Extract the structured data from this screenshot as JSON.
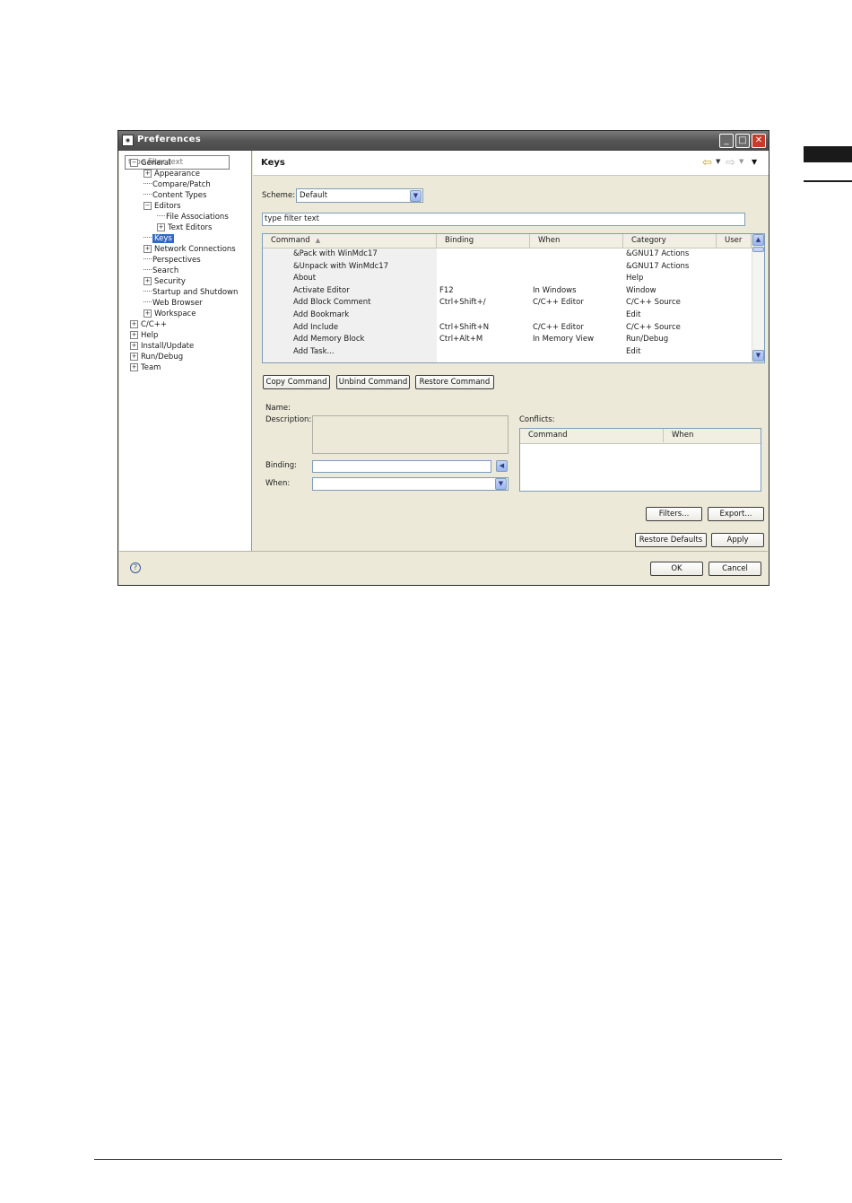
{
  "window": {
    "title": "Preferences",
    "minimize": "_",
    "maximize": "□",
    "close": "✕"
  },
  "sidebar": {
    "filter_placeholder": "type filter text",
    "items": [
      {
        "label": "General",
        "expander": "⊟"
      },
      {
        "label": "Appearance",
        "expander": "⊞"
      },
      {
        "label": "Compare/Patch",
        "expander": ""
      },
      {
        "label": "Content Types",
        "expander": ""
      },
      {
        "label": "Editors",
        "expander": "⊟"
      },
      {
        "label": "File Associations",
        "expander": ""
      },
      {
        "label": "Text Editors",
        "expander": "⊞"
      },
      {
        "label": "Keys",
        "expander": ""
      },
      {
        "label": "Network Connections",
        "expander": "⊞"
      },
      {
        "label": "Perspectives",
        "expander": ""
      },
      {
        "label": "Search",
        "expander": ""
      },
      {
        "label": "Security",
        "expander": "⊞"
      },
      {
        "label": "Startup and Shutdown",
        "expander": ""
      },
      {
        "label": "Web Browser",
        "expander": ""
      },
      {
        "label": "Workspace",
        "expander": "⊞"
      },
      {
        "label": "C/C++",
        "expander": "⊞"
      },
      {
        "label": "Help",
        "expander": "⊞"
      },
      {
        "label": "Install/Update",
        "expander": "⊞"
      },
      {
        "label": "Run/Debug",
        "expander": "⊞"
      },
      {
        "label": "Team",
        "expander": "⊞"
      }
    ]
  },
  "page": {
    "title": "Keys",
    "scheme_label": "Scheme:",
    "scheme_value": "Default",
    "filter_value": "type filter text",
    "columns": [
      "Command",
      "Binding",
      "When",
      "Category",
      "User"
    ],
    "rows": [
      [
        "&Pack with WinMdc17",
        "",
        "",
        "&GNU17 Actions",
        ""
      ],
      [
        "&Unpack with WinMdc17",
        "",
        "",
        "&GNU17 Actions",
        ""
      ],
      [
        "About",
        "",
        "",
        "Help",
        ""
      ],
      [
        "Activate Editor",
        "F12",
        "In Windows",
        "Window",
        ""
      ],
      [
        "Add Block Comment",
        "Ctrl+Shift+/",
        "C/C++ Editor",
        "C/C++ Source",
        ""
      ],
      [
        "Add Bookmark",
        "",
        "",
        "Edit",
        ""
      ],
      [
        "Add Include",
        "Ctrl+Shift+N",
        "C/C++ Editor",
        "C/C++ Source",
        ""
      ],
      [
        "Add Memory Block",
        "Ctrl+Alt+M",
        "In Memory View",
        "Run/Debug",
        ""
      ],
      [
        "Add Task...",
        "",
        "",
        "Edit",
        ""
      ]
    ],
    "buttons": {
      "copy": "Copy Command",
      "unbind": "Unbind Command",
      "restore": "Restore Command"
    },
    "name_label": "Name:",
    "description_label": "Description:",
    "binding_label": "Binding:",
    "when_label": "When:",
    "conflicts_label": "Conflicts:",
    "conflicts_columns": [
      "Command",
      "When"
    ],
    "filters_button": "Filters...",
    "export_button": "Export...",
    "restore_defaults_button": "Restore Defaults",
    "apply_button": "Apply"
  },
  "footer": {
    "ok_button": "OK",
    "cancel_button": "Cancel",
    "help": "?"
  }
}
